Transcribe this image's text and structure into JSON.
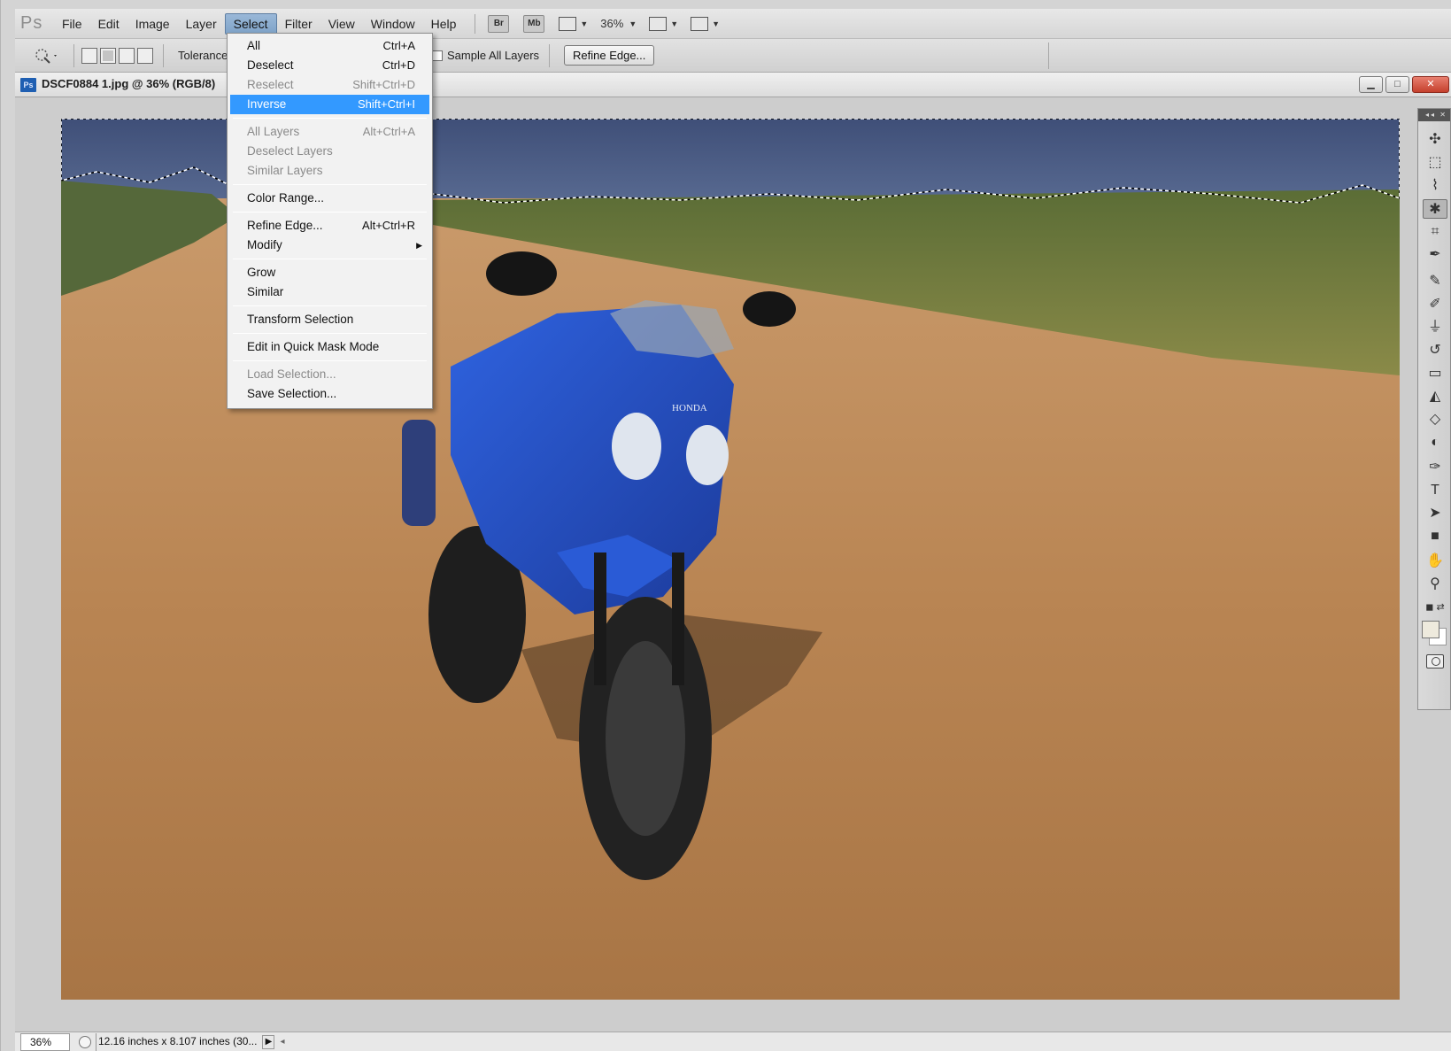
{
  "app": {
    "logo": "Ps"
  },
  "menubar": {
    "items": [
      "File",
      "Edit",
      "Image",
      "Layer",
      "Select",
      "Filter",
      "View",
      "Window",
      "Help"
    ],
    "active": "Select",
    "bridge_label": "Br",
    "minibridge_label": "Mb",
    "zoom": "36%"
  },
  "options": {
    "tolerance_label": "Tolerance:",
    "sample_all_layers_label": "Sample All Layers",
    "refine_edge_button": "Refine Edge..."
  },
  "document": {
    "title": "DSCF0884 1.jpg @ 36% (RGB/8)"
  },
  "select_menu": {
    "groups": [
      [
        {
          "label": "All",
          "shortcut": "Ctrl+A",
          "enabled": true
        },
        {
          "label": "Deselect",
          "shortcut": "Ctrl+D",
          "enabled": true
        },
        {
          "label": "Reselect",
          "shortcut": "Shift+Ctrl+D",
          "enabled": false
        },
        {
          "label": "Inverse",
          "shortcut": "Shift+Ctrl+I",
          "enabled": true,
          "highlighted": true
        }
      ],
      [
        {
          "label": "All Layers",
          "shortcut": "Alt+Ctrl+A",
          "enabled": false
        },
        {
          "label": "Deselect Layers",
          "shortcut": "",
          "enabled": false
        },
        {
          "label": "Similar Layers",
          "shortcut": "",
          "enabled": false
        }
      ],
      [
        {
          "label": "Color Range...",
          "shortcut": "",
          "enabled": true
        }
      ],
      [
        {
          "label": "Refine Edge...",
          "shortcut": "Alt+Ctrl+R",
          "enabled": true
        },
        {
          "label": "Modify",
          "shortcut": "",
          "enabled": true,
          "submenu": true
        }
      ],
      [
        {
          "label": "Grow",
          "shortcut": "",
          "enabled": true
        },
        {
          "label": "Similar",
          "shortcut": "",
          "enabled": true
        }
      ],
      [
        {
          "label": "Transform Selection",
          "shortcut": "",
          "enabled": true
        }
      ],
      [
        {
          "label": "Edit in Quick Mask Mode",
          "shortcut": "",
          "enabled": true
        }
      ],
      [
        {
          "label": "Load Selection...",
          "shortcut": "",
          "enabled": false
        },
        {
          "label": "Save Selection...",
          "shortcut": "",
          "enabled": true
        }
      ]
    ]
  },
  "statusbar": {
    "zoom": "36%",
    "doc_info": "12.16 inches x 8.107 inches (30..."
  },
  "colors": {
    "menu_highlight": "#3399ff",
    "sky": "#4a5f86",
    "dirt_road": "#bd8a5a",
    "motorcycle_blue": "#1f4fc8",
    "crop_green": "#6b7a38"
  },
  "photo": {
    "brand_text": "HONDA"
  },
  "tools": [
    "move-tool-icon",
    "marquee-tool-icon",
    "lasso-tool-icon",
    "quick-selection-tool-icon",
    "crop-tool-icon",
    "eyedropper-tool-icon",
    "spot-healing-tool-icon",
    "brush-tool-icon",
    "clone-stamp-tool-icon",
    "history-brush-tool-icon",
    "eraser-tool-icon",
    "paint-bucket-tool-icon",
    "blur-tool-icon",
    "dodge-tool-icon",
    "pen-tool-icon",
    "type-tool-icon",
    "path-selection-tool-icon",
    "rectangle-tool-icon",
    "hand-tool-icon",
    "zoom-tool-icon"
  ]
}
